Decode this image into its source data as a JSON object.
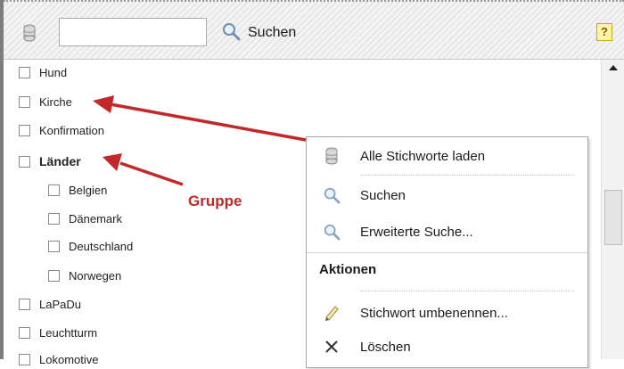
{
  "toolbar": {
    "search_value": "",
    "search_label": "Suchen",
    "help_label": "?"
  },
  "tree": {
    "items": [
      {
        "label": "Hund",
        "bold": false,
        "indent": 0
      },
      {
        "label": "Kirche",
        "bold": false,
        "indent": 0
      },
      {
        "label": "Konfirmation",
        "bold": false,
        "indent": 0
      },
      {
        "label": "Länder",
        "bold": true,
        "indent": 0
      },
      {
        "label": "Belgien",
        "bold": false,
        "indent": 1
      },
      {
        "label": "Dänemark",
        "bold": false,
        "indent": 1
      },
      {
        "label": "Deutschland",
        "bold": false,
        "indent": 1
      },
      {
        "label": "Norwegen",
        "bold": false,
        "indent": 1
      },
      {
        "label": "LaPaDu",
        "bold": false,
        "indent": 0
      },
      {
        "label": "Leuchtturm",
        "bold": false,
        "indent": 0
      },
      {
        "label": "Lokomotive",
        "bold": false,
        "indent": 0
      }
    ]
  },
  "context_menu": {
    "load_all": "Alle Stichworte laden",
    "search": "Suchen",
    "advanced_search": "Erweiterte Suche...",
    "actions_header": "Aktionen",
    "rename": "Stichwort umbenennen...",
    "delete": "Löschen"
  },
  "annotation": {
    "gruppe": "Gruppe",
    "arrow_color": "#c0282a"
  },
  "icons": {
    "toolbar_db": "database-icon",
    "toolbar_search": "magnifier-icon",
    "help": "help-icon",
    "menu_load": "database-icon",
    "menu_search": "magnifier-icon",
    "menu_advanced": "magnifier-icon",
    "menu_rename": "pencil-icon",
    "menu_delete": "cross-icon"
  }
}
